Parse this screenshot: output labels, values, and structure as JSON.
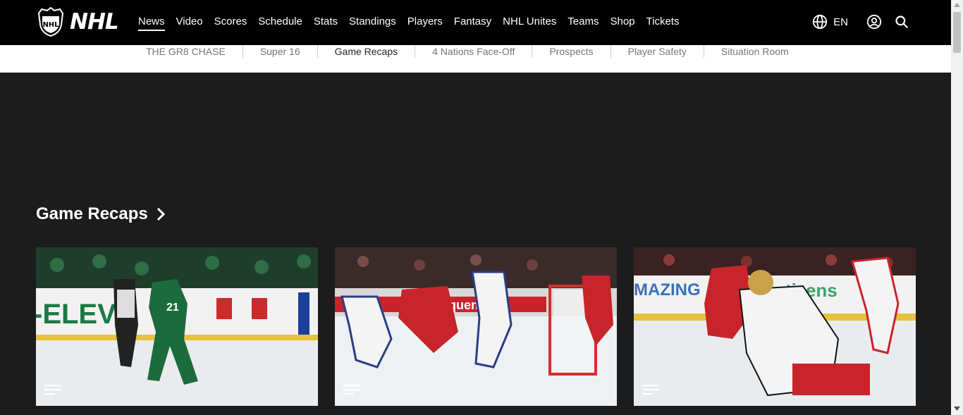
{
  "brand": {
    "wordmark": "NHL"
  },
  "nav": {
    "items": [
      {
        "label": "News",
        "active": true
      },
      {
        "label": "Video"
      },
      {
        "label": "Scores"
      },
      {
        "label": "Schedule"
      },
      {
        "label": "Stats"
      },
      {
        "label": "Standings"
      },
      {
        "label": "Players"
      },
      {
        "label": "Fantasy"
      },
      {
        "label": "NHL Unites"
      },
      {
        "label": "Teams"
      },
      {
        "label": "Shop"
      },
      {
        "label": "Tickets"
      }
    ],
    "language": "EN",
    "icons": {
      "language": "globe-icon",
      "account": "user-circle-icon",
      "search": "search-icon"
    }
  },
  "subnav": {
    "items": [
      {
        "label": "THE GR8 CHASE"
      },
      {
        "label": "Super 16"
      },
      {
        "label": "Game Recaps",
        "active": true
      },
      {
        "label": "4 Nations Face-Off"
      },
      {
        "label": "Prospects"
      },
      {
        "label": "Player Safety"
      },
      {
        "label": "Situation Room"
      }
    ]
  },
  "section": {
    "title": "Game Recaps",
    "icon": "chevron-right-icon",
    "cards": [
      {
        "icon": "article-icon",
        "theme": "stars"
      },
      {
        "icon": "article-icon",
        "theme": "canadiens-rangers"
      },
      {
        "icon": "article-icon",
        "theme": "devils-senators"
      }
    ]
  },
  "colors": {
    "nav_bg": "#000000",
    "page_bg": "#1c1c1c",
    "subnav_bg": "#ffffff"
  }
}
